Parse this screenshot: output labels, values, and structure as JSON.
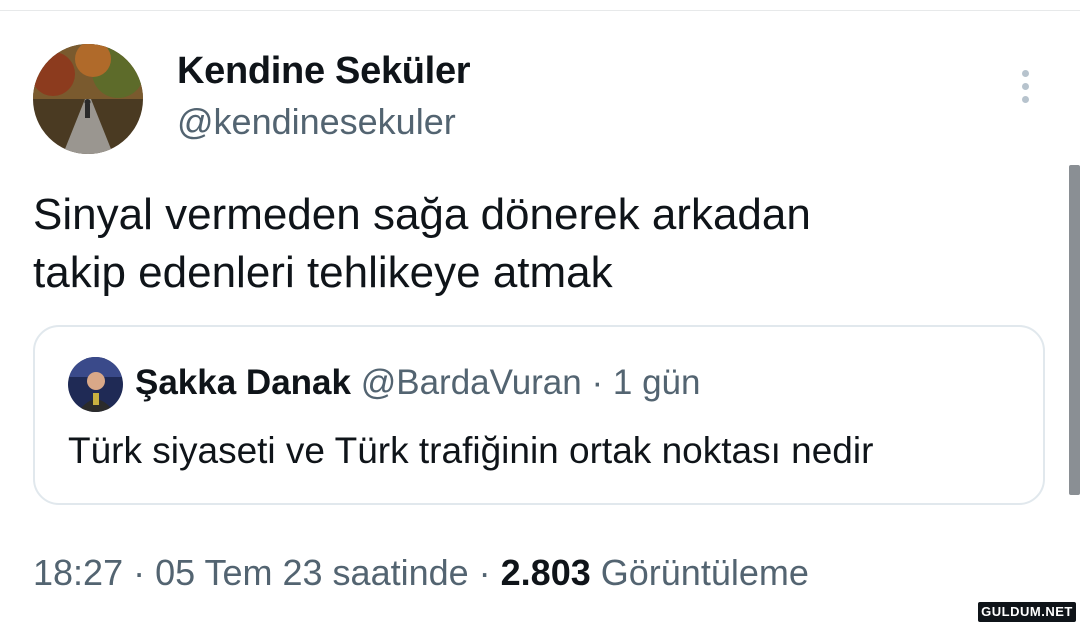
{
  "author": {
    "display_name": "Kendine Seküler",
    "handle": "@kendinesekuler"
  },
  "more_icon": "more-vertical-icon",
  "tweet": {
    "text_line1": "Sinyal vermeden sağa dönerek arkadan",
    "text_line2": "takip edenleri tehlikeye atmak"
  },
  "quoted_tweet": {
    "display_name": "Şakka Danak",
    "handle": "@BardaVuran",
    "separator": " · ",
    "time_ago": "1 gün",
    "text": "Türk siyaseti ve Türk trafiğinin ortak noktası nedir"
  },
  "meta": {
    "time": "18:27",
    "separator1": " · ",
    "date": "05 Tem 23 saatinde",
    "separator2": " · ",
    "views_count": "2.803",
    "views_label": "Görüntüleme"
  },
  "watermark": "GULDUM.NET",
  "colors": {
    "text_primary": "#0f1419",
    "text_secondary": "#536471",
    "border": "#e1e8ed"
  }
}
